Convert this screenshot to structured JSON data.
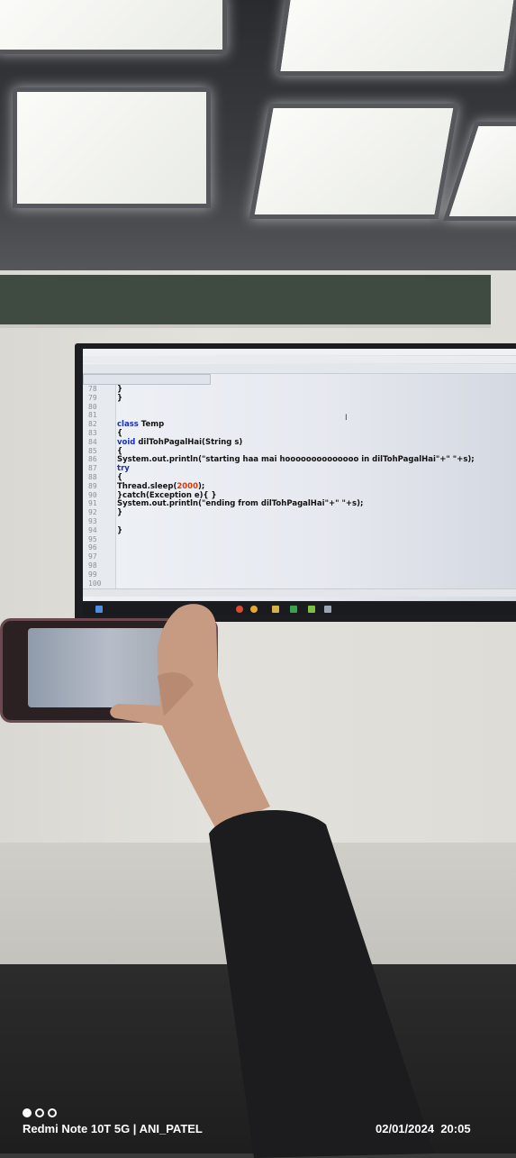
{
  "scene": "classroom-photo",
  "editor": {
    "lines": [
      {
        "n": "78",
        "text": "}"
      },
      {
        "n": "79",
        "text": "}"
      },
      {
        "n": "80",
        "text": ""
      },
      {
        "n": "81",
        "text": ""
      },
      {
        "n": "82",
        "kw": "class",
        "text": " Temp"
      },
      {
        "n": "83",
        "text": "{"
      },
      {
        "n": "84",
        "kw": " void",
        "text": " dilTohPagalHai(String s)"
      },
      {
        "n": "85",
        "text": "{"
      },
      {
        "n": "86",
        "text": "System.out.println(\"starting haa mai hoooooooooooooo in dilTohPagalHai\"+\"  \"+s);"
      },
      {
        "n": "87",
        "kw": "try",
        "text": ""
      },
      {
        "n": "88",
        "text": "{"
      },
      {
        "n": "89",
        "text": "Thread.sleep(",
        "num": "2000",
        "after": ");"
      },
      {
        "n": "90",
        "text": " }catch(Exception e){ }"
      },
      {
        "n": "91",
        "text": "System.out.println(\"ending from dilTohPagalHai\"+\"  \"+s);"
      },
      {
        "n": "92",
        "text": " }"
      },
      {
        "n": "93",
        "text": ""
      },
      {
        "n": "94",
        "text": "   }"
      },
      {
        "n": "95",
        "text": ""
      },
      {
        "n": "96",
        "text": ""
      },
      {
        "n": "97",
        "text": ""
      },
      {
        "n": "98",
        "text": ""
      },
      {
        "n": "99",
        "text": ""
      },
      {
        "n": "100",
        "text": ""
      }
    ]
  },
  "watermark": {
    "device": "Redmi Note 10T 5G | ANI_PATEL",
    "date": "02/01/2024",
    "time": "20:05"
  },
  "colors": {
    "keyword": "#1b2fb5",
    "number": "#d13a10",
    "screen": "#eef1f6"
  },
  "icons": [
    "cursor-icon",
    "windows-start-icon",
    "browser-icon",
    "folder-icon",
    "editor-icon",
    "camera-dots-icon"
  ]
}
